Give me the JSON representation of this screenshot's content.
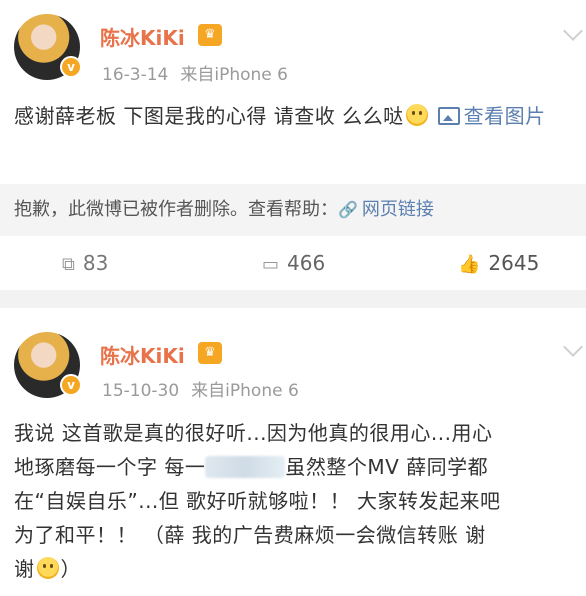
{
  "post1": {
    "username": "陈冰KiKi",
    "vip_icon": "vip-crown-icon",
    "date": "16-3-14",
    "source": "来自iPhone 6",
    "text": "感谢薛老板 下图是我的心得 请查收 么么哒",
    "view_image": "查看图片",
    "deleted_notice": "抱歉，此微博已被作者删除。查看帮助：",
    "web_link": "网页链接",
    "reposts": "83",
    "comments": "466",
    "likes": "2645"
  },
  "post2": {
    "username": "陈冰KiKi",
    "vip_icon": "vip-crown-icon",
    "date": "15-10-30",
    "source": "来自iPhone 6",
    "text_line1": "我说 这首歌是真的很好听...因为他真的很用心...用心",
    "text_line2a": "地琢磨每一个字 每一",
    "text_line2b": "虽然整个MV 薛同学都",
    "text_line3": "在“自娱自乐”...但 歌好听就够啦！！ 大家转发起来吧",
    "text_line4": "为了和平！！ （薛 我的广告费麻烦一会微信转账 谢",
    "text_line5a": "谢",
    "text_line5b": "）"
  },
  "colors": {
    "username": "#e8734a",
    "link": "#5b7fb0",
    "meta": "#9a9a9a",
    "separator": "#f2f2f2"
  }
}
